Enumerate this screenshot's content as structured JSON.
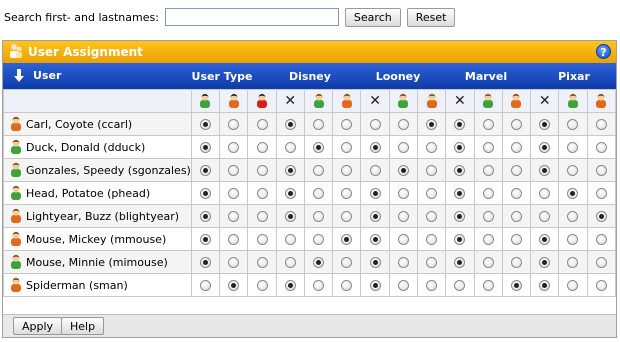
{
  "search": {
    "label": "Search first- and lastnames:",
    "value": "",
    "button": "Search",
    "reset": "Reset"
  },
  "panel": {
    "title": "User Assignment",
    "help": "?"
  },
  "header": {
    "user_label": "User",
    "groups": [
      "User Type",
      "Disney",
      "Looney",
      "Marvel",
      "Pixar"
    ]
  },
  "icon_row": [
    [
      "user-green-black",
      "user-orange-black",
      "user-red-black"
    ],
    [
      "none",
      "user-green",
      "user-orange"
    ],
    [
      "none",
      "user-green",
      "user-orange"
    ],
    [
      "none",
      "user-green",
      "user-orange"
    ],
    [
      "none",
      "user-green",
      "user-orange"
    ]
  ],
  "users": [
    {
      "name": "Carl, Coyote (ccarl)",
      "icon": "user-orange",
      "sel": [
        0,
        0,
        2,
        0,
        0
      ]
    },
    {
      "name": "Duck, Donald (dduck)",
      "icon": "user-green",
      "sel": [
        0,
        1,
        0,
        0,
        0
      ]
    },
    {
      "name": "Gonzales, Speedy (sgonzales)",
      "icon": "user-green",
      "sel": [
        0,
        0,
        1,
        0,
        0
      ]
    },
    {
      "name": "Head, Potatoe (phead)",
      "icon": "user-green",
      "sel": [
        0,
        0,
        0,
        0,
        1
      ]
    },
    {
      "name": "Lightyear, Buzz (blightyear)",
      "icon": "user-orange",
      "sel": [
        0,
        0,
        0,
        0,
        2
      ]
    },
    {
      "name": "Mouse, Mickey (mmouse)",
      "icon": "user-orange",
      "sel": [
        0,
        2,
        0,
        0,
        0
      ]
    },
    {
      "name": "Mouse, Minnie (mimouse)",
      "icon": "user-green",
      "sel": [
        0,
        1,
        0,
        0,
        0
      ]
    },
    {
      "name": "Spiderman (sman)",
      "icon": "user-orange",
      "sel": [
        1,
        0,
        0,
        2,
        0
      ]
    }
  ],
  "footer": {
    "apply": "Apply",
    "help": "Help"
  },
  "colors": {
    "title_bar": "#f0a800",
    "header_bar": "#1e4fc4",
    "green_shirt": "#3da33d",
    "orange_shirt": "#e06a1a",
    "red_shirt": "#d62020"
  }
}
